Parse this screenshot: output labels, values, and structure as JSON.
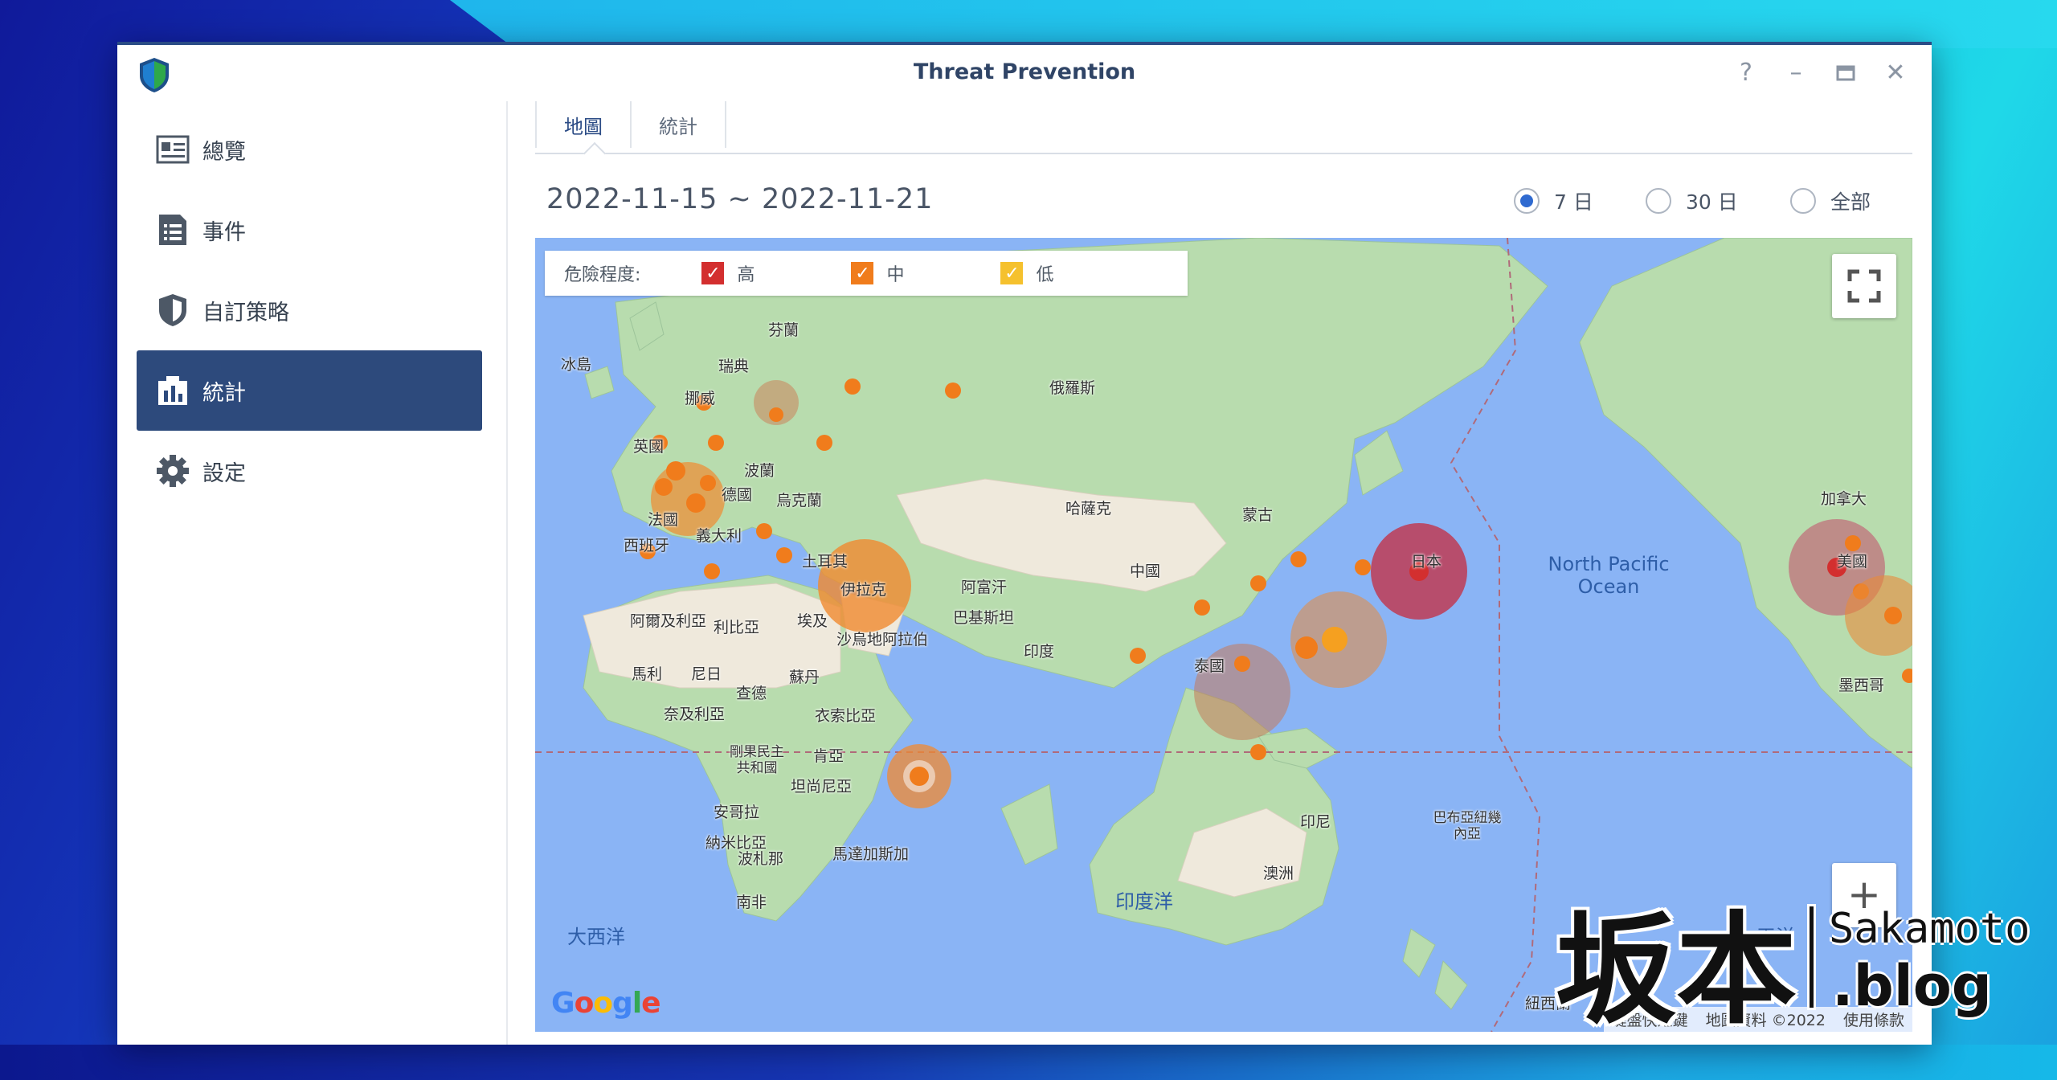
{
  "window": {
    "title": "Threat Prevention",
    "controls": [
      "help-icon",
      "minimize-icon",
      "maximize-icon",
      "close-icon"
    ]
  },
  "sidebar": {
    "items": [
      {
        "label": "總覽",
        "icon": "overview-card-icon"
      },
      {
        "label": "事件",
        "icon": "event-list-icon"
      },
      {
        "label": "自訂策略",
        "icon": "shield-icon"
      },
      {
        "label": "統計",
        "icon": "statistics-icon",
        "active": true
      },
      {
        "label": "設定",
        "icon": "gear-icon"
      }
    ]
  },
  "tabs": [
    {
      "label": "地圖",
      "active": true
    },
    {
      "label": "統計"
    }
  ],
  "date_range": "2022-11-15 ~ 2022-11-21",
  "period": {
    "options": [
      "7 日",
      "30 日",
      "全部"
    ],
    "selected": "7 日"
  },
  "legend": {
    "caption": "危險程度:",
    "levels": [
      {
        "label": "高",
        "color": "#d32f2f"
      },
      {
        "label": "中",
        "color": "#f07c1c"
      },
      {
        "label": "低",
        "color": "#f5c12e"
      }
    ]
  },
  "map": {
    "labels": [
      "芬蘭",
      "冰島",
      "瑞典",
      "挪威",
      "英國",
      "波蘭",
      "德國",
      "烏克蘭",
      "俄羅斯",
      "哈薩克",
      "蒙古",
      "法國",
      "義大利",
      "西班牙",
      "土耳其",
      "伊拉克",
      "阿富汗",
      "巴基斯坦",
      "中國",
      "日本",
      "阿爾及利亞",
      "利比亞",
      "埃及",
      "沙烏地阿拉伯",
      "印度",
      "泰國",
      "馬利",
      "尼日",
      "蘇丹",
      "查德",
      "奈及利亞",
      "衣索比亞",
      "剛果民主共和國",
      "肯亞",
      "坦尚尼亞",
      "安哥拉",
      "納米比亞",
      "波札那",
      "南非",
      "馬達加斯加",
      "印尼",
      "巴布亞紐幾內亞",
      "澳洲",
      "紐西蘭",
      "加拿大",
      "美國",
      "墨西哥"
    ],
    "oceans": [
      "North Pacific Ocean",
      "大西洋",
      "印度洋",
      "平洋"
    ],
    "attribution": [
      "鍵盤快速鍵",
      "地圖資料 ©2022",
      "使用條款"
    ],
    "provider": "Google"
  },
  "watermark": {
    "kanji": "坂本",
    "latin": "Sakamoto",
    "suffix": ".blog"
  }
}
